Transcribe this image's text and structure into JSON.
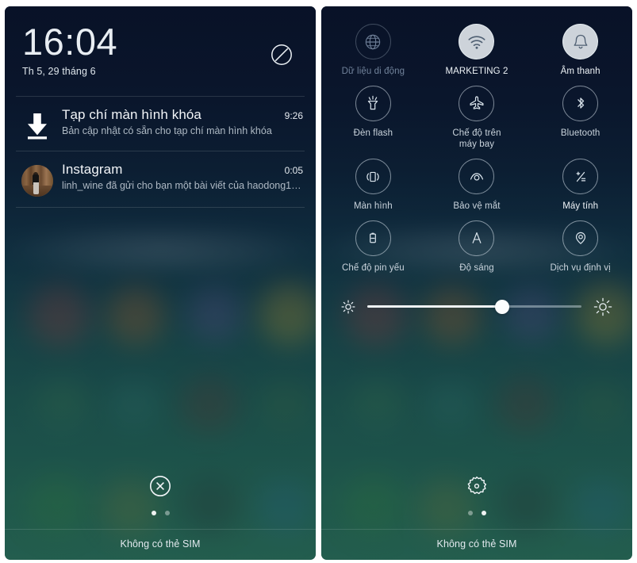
{
  "lockscreen": {
    "clock": {
      "time": "16:04",
      "date": "Th 5, 29 tháng 6"
    },
    "dnd_icon": "do-not-disturb-icon",
    "notifications": [
      {
        "icon": "download-icon",
        "title": "Tạp chí màn hình khóa",
        "text": "Bản cập nhật có sẵn cho tạp chí màn hình khóa",
        "time": "9:26"
      },
      {
        "icon": "instagram-avatar",
        "title": "Instagram",
        "text": "linh_wine đã gửi cho bạn một bài viết của haodong16…",
        "time": "0:05"
      }
    ],
    "bottom_button": "clear-all-icon",
    "page_dots": {
      "count": 2,
      "active": 0
    },
    "sim_status": "Không có thẻ SIM"
  },
  "quicksettings": {
    "toggles": [
      {
        "icon": "globe-icon",
        "label": "Dữ liệu di động",
        "state": "disabled"
      },
      {
        "icon": "wifi-icon",
        "label": "MARKETING 2",
        "state": "on"
      },
      {
        "icon": "bell-icon",
        "label": "Âm thanh",
        "state": "on"
      },
      {
        "icon": "flashlight-icon",
        "label": "Đèn flash",
        "state": "off"
      },
      {
        "icon": "airplane-icon",
        "label": "Chế độ trên máy bay",
        "state": "off"
      },
      {
        "icon": "bluetooth-icon",
        "label": "Bluetooth",
        "state": "off"
      },
      {
        "icon": "rotate-icon",
        "label": "Màn hình",
        "state": "off"
      },
      {
        "icon": "eye-icon",
        "label": "Bảo vệ mắt",
        "state": "off"
      },
      {
        "icon": "calculator-icon",
        "label": "Máy tính",
        "state": "off"
      },
      {
        "icon": "battery-icon",
        "label": "Chế độ pin yếu",
        "state": "off"
      },
      {
        "icon": "auto-brightness-icon",
        "label": "Độ sáng",
        "state": "off"
      },
      {
        "icon": "location-pin-icon",
        "label": "Dịch vụ định vị",
        "state": "off"
      }
    ],
    "brightness": {
      "left_icon": "sun-low-icon",
      "right_icon": "sun-high-icon",
      "value_percent": 63
    },
    "bottom_button": "settings-gear-icon",
    "page_dots": {
      "count": 2,
      "active": 1
    },
    "sim_status": "Không có thẻ SIM"
  },
  "colors": {
    "accent_light": "#e8eef3",
    "top_background": "#0e1b33",
    "bottom_background": "#2e6d58",
    "label_text": "#c9d3dc",
    "dim_text": "#71829a"
  }
}
